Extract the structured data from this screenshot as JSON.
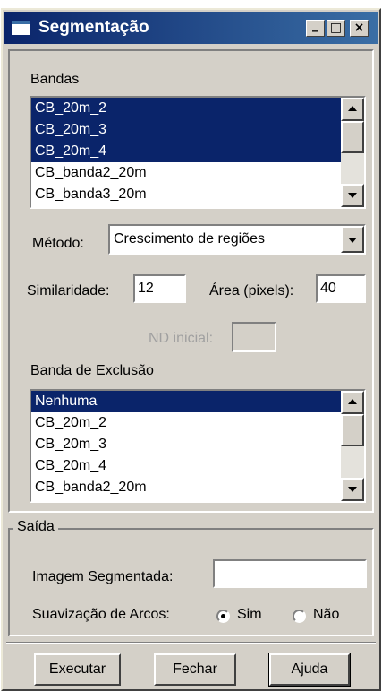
{
  "window": {
    "title": "Segmentação",
    "controls": [
      "_",
      "□",
      "×"
    ]
  },
  "bands": {
    "label": "Bandas",
    "items": [
      {
        "text": "CB_20m_2",
        "selected": true
      },
      {
        "text": "CB_20m_3",
        "selected": true
      },
      {
        "text": "CB_20m_4",
        "selected": true
      },
      {
        "text": "CB_banda2_20m",
        "selected": false
      },
      {
        "text": "CB_banda3_20m",
        "selected": false
      }
    ]
  },
  "method": {
    "label": "Método:",
    "value": "Crescimento de regiões"
  },
  "similarity": {
    "label": "Similaridade:",
    "value": "12"
  },
  "area": {
    "label": "Área (pixels):",
    "value": "40"
  },
  "nd": {
    "label": "ND inicial:",
    "value": ""
  },
  "exclusion": {
    "label": "Banda de Exclusão",
    "items": [
      {
        "text": "Nenhuma",
        "selected": true
      },
      {
        "text": "CB_20m_2",
        "selected": false
      },
      {
        "text": "CB_20m_3",
        "selected": false
      },
      {
        "text": "CB_20m_4",
        "selected": false
      },
      {
        "text": "CB_banda2_20m",
        "selected": false
      }
    ]
  },
  "output": {
    "label": "Saída",
    "image_label": "Imagem Segmentada:",
    "image_value": "",
    "smoothing_label": "Suavização de Arcos:",
    "yes_label": "Sim",
    "no_label": "Não",
    "smoothing": "Sim"
  },
  "buttons": {
    "execute": "Executar",
    "close": "Fechar",
    "help": "Ajuda"
  },
  "colors": {
    "title_start": "#0a246a",
    "title_end": "#3a6ea5",
    "face": "#d4d0c8",
    "selection": "#0a246a"
  }
}
